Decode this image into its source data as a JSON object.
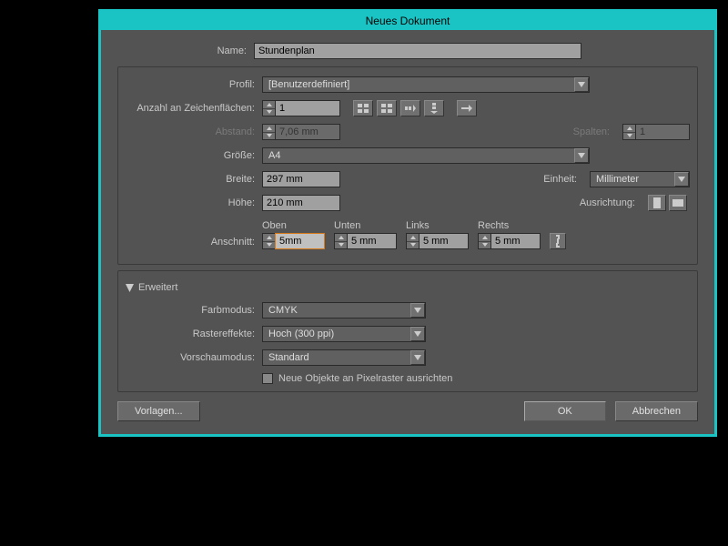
{
  "title": "Neues Dokument",
  "labels": {
    "name": "Name:",
    "profile": "Profil:",
    "artboards": "Anzahl an Zeichenflächen:",
    "spacing": "Abstand:",
    "columns": "Spalten:",
    "size": "Größe:",
    "width": "Breite:",
    "height": "Höhe:",
    "units": "Einheit:",
    "orientation": "Ausrichtung:",
    "bleed": "Anschnitt:",
    "top": "Oben",
    "bottom": "Unten",
    "left": "Links",
    "right": "Rechts",
    "advanced": "Erweitert",
    "colormode": "Farbmodus:",
    "rastereffects": "Rastereffekte:",
    "previewmode": "Vorschaumodus:",
    "pixelalign": "Neue Objekte an Pixelraster ausrichten"
  },
  "values": {
    "name": "Stundenplan",
    "profile": "[Benutzerdefiniert]",
    "artboards": "1",
    "spacing": "7,06 mm",
    "columns": "1",
    "size": "A4",
    "width": "297 mm",
    "height": "210 mm",
    "units": "Millimeter",
    "bleed_top": "5mm",
    "bleed_bottom": "5 mm",
    "bleed_left": "5 mm",
    "bleed_right": "5 mm",
    "colormode": "CMYK",
    "rastereffects": "Hoch (300 ppi)",
    "previewmode": "Standard"
  },
  "buttons": {
    "templates": "Vorlagen...",
    "ok": "OK",
    "cancel": "Abbrechen"
  }
}
